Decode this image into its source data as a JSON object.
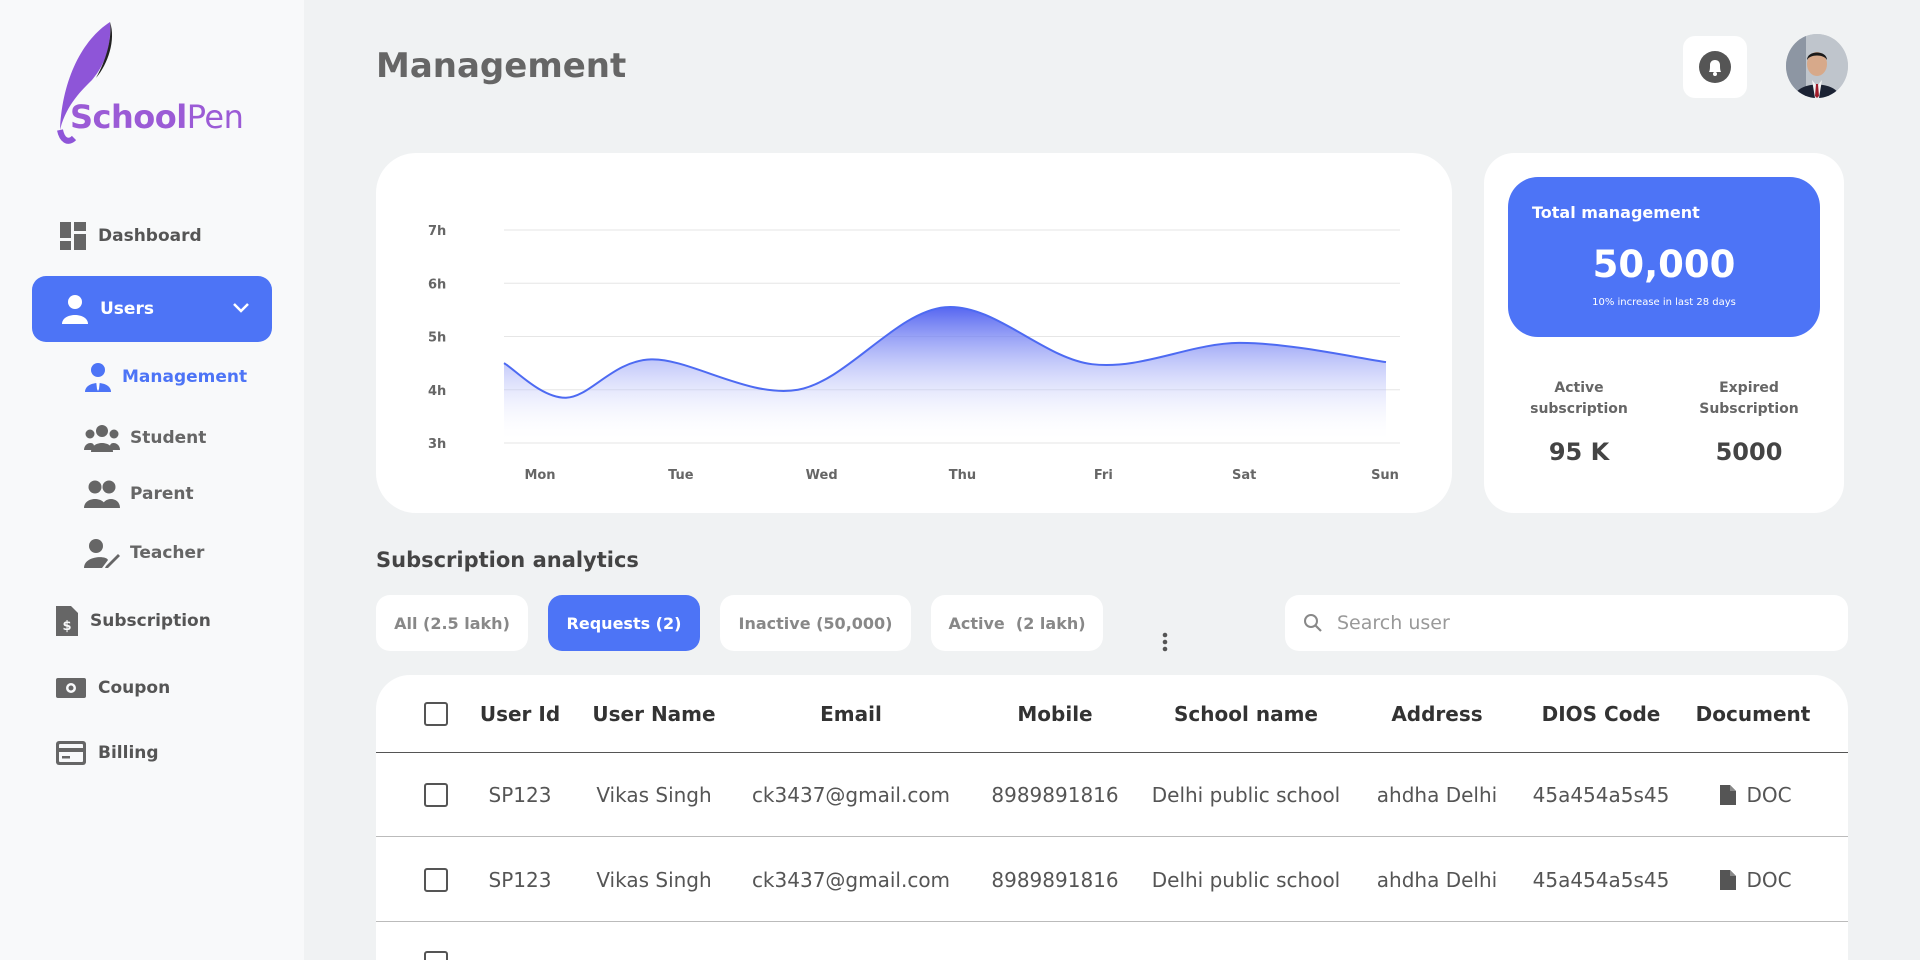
{
  "brand": {
    "name_part1": "School",
    "name_part2": "Pen"
  },
  "sidebar": {
    "items": [
      {
        "label": "Dashboard",
        "icon": "dashboard-icon"
      },
      {
        "label": "Users",
        "icon": "user-icon"
      },
      {
        "label": "Subscription",
        "icon": "invoice-icon"
      },
      {
        "label": "Coupon",
        "icon": "money-icon"
      },
      {
        "label": "Billing",
        "icon": "credit-card-icon"
      }
    ],
    "users_subitems": [
      {
        "label": "Management",
        "icon": "manager-icon",
        "active": true
      },
      {
        "label": "Student",
        "icon": "group-icon"
      },
      {
        "label": "Parent",
        "icon": "people-icon"
      },
      {
        "label": "Teacher",
        "icon": "user-edit-icon"
      }
    ]
  },
  "header": {
    "title": "Management"
  },
  "chart_data": {
    "type": "area",
    "x": [
      "Mon",
      "Tue",
      "Wed",
      "Thu",
      "Fri",
      "Sat",
      "Sun"
    ],
    "series": [
      {
        "values": [
          3.85,
          4.57,
          4.0,
          5.55,
          4.48,
          4.88,
          4.52
        ]
      }
    ],
    "ylim": [
      3,
      7
    ],
    "yticks": [
      "3h",
      "4h",
      "5h",
      "6h",
      "7h"
    ],
    "grid": true
  },
  "summary": {
    "total_label": "Total management",
    "total_value": "50,000",
    "total_sub": "10% increase in last 28 days",
    "active_label": "Active subscription",
    "active_value": "95 K",
    "expired_label": "Expired Subscription",
    "expired_value": "5000"
  },
  "analytics": {
    "title": "Subscription analytics",
    "filters": [
      "All (2.5 lakh)",
      "Requests (2)",
      "Inactive (50,000)",
      "Active  (2 lakh)"
    ],
    "active_filter": "Requests (2)",
    "search_placeholder": "Search user"
  },
  "table": {
    "columns": [
      "User Id",
      "User Name",
      "Email",
      "Mobile",
      "School name",
      "Address",
      "DIOS Code",
      "Document"
    ],
    "rows": [
      [
        "SP123",
        "Vikas Singh",
        "ck3437@gmail.com",
        "8989891816",
        "Delhi public school",
        "ahdha Delhi",
        "45a454a5s45",
        "DOC"
      ],
      [
        "SP123",
        "Vikas Singh",
        "ck3437@gmail.com",
        "8989891816",
        "Delhi public school",
        "ahdha Delhi",
        "45a454a5s45",
        "DOC"
      ]
    ]
  },
  "colors": {
    "accent": "#4d74f6",
    "brand": "#9b5bd6",
    "background": "#f0f2f3"
  }
}
